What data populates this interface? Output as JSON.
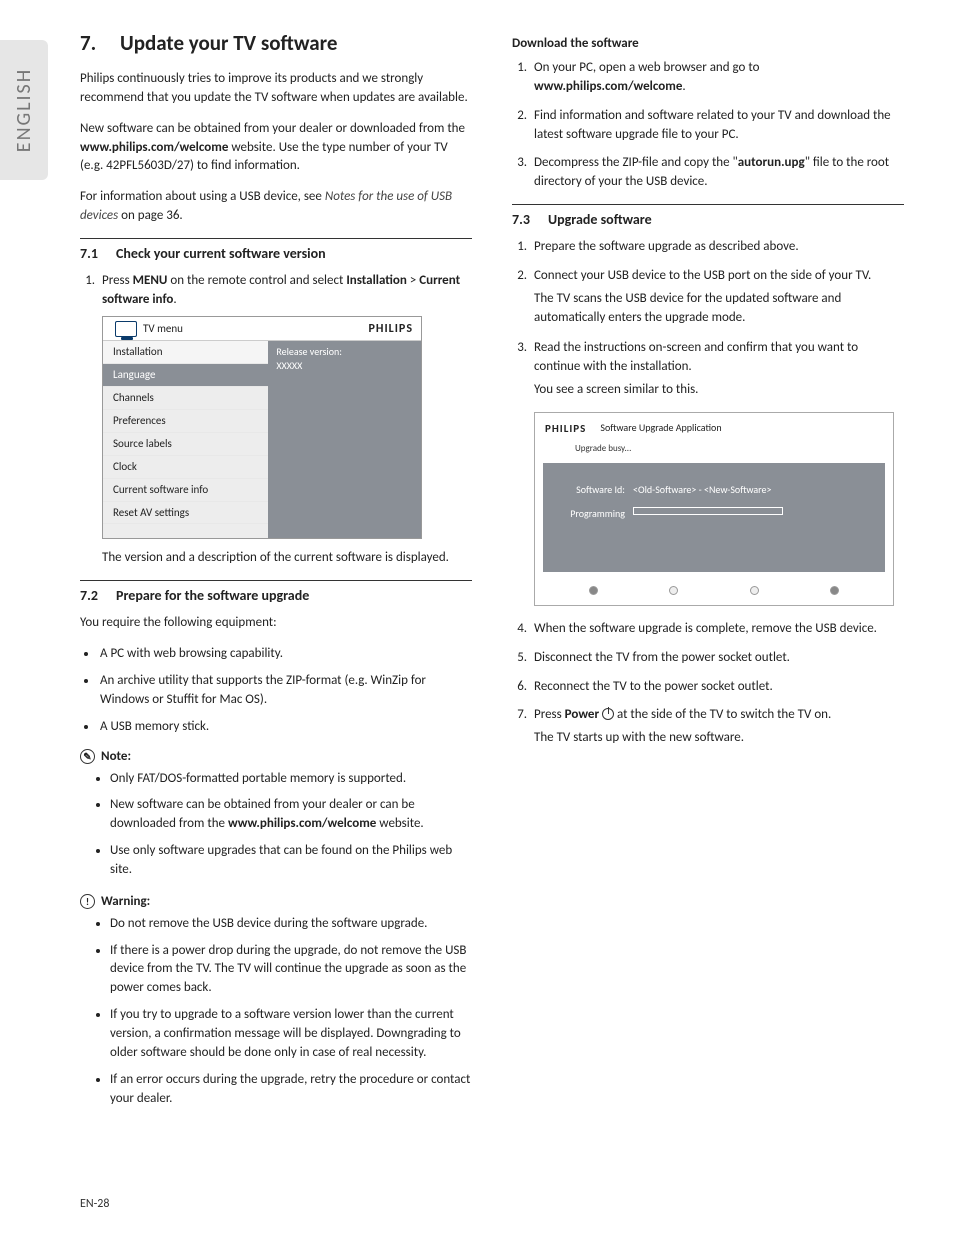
{
  "sideTab": "ENGLISH",
  "pageNumber": "EN-28",
  "chapter": {
    "num": "7.",
    "title": "Update your TV software"
  },
  "intro1a": "Philips continuously tries to improve its products and we strongly recommend that you update the TV software when updates are available.",
  "intro2a": "New software can be obtained from your dealer or downloaded from the ",
  "intro2b": "www.philips.com/welcome",
  "intro2c": " website.  Use the type number of your TV (e.g.  42PFL5603D/27) to find information.",
  "intro3a": "For information about using a USB device, see ",
  "intro3b": "Notes for the use of USB devices",
  "intro3c": " on page 36.",
  "s71": {
    "num": "7.1",
    "title": "Check your current software version"
  },
  "s71_step1a": "Press ",
  "s71_step1b": "MENU",
  "s71_step1c": " on the remote control and select ",
  "s71_step1d": "Installation",
  "s71_step1e": " > ",
  "s71_step1f": "Current software info",
  "s71_step1g": ".",
  "menuShot": {
    "brand": "PHILIPS",
    "tvMenu": "TV menu",
    "items": [
      "Installation",
      "Language",
      "Channels",
      "Preferences",
      "Source labels",
      "Clock",
      "Current software info",
      "Reset AV settings"
    ],
    "rightLabel": "Release version:",
    "rightValue": "XXXXX"
  },
  "s71_caption": "The version and a description of the current software is displayed.",
  "s72": {
    "num": "7.2",
    "title": "Prepare for the software upgrade"
  },
  "s72_intro": "You require the following equipment:",
  "s72_bullets": [
    "A PC with web browsing capability.",
    "An archive utility that supports the ZIP-format (e.g.  WinZip for Windows or Stuffit for Mac OS).",
    "A USB memory stick."
  ],
  "noteTitle": "Note:",
  "noteItems": {
    "n1": "Only FAT/DOS-formatted portable memory is supported.",
    "n2a": "New software can be obtained from your dealer or can be downloaded from the ",
    "n2b": "www.philips.com/welcome",
    "n2c": " website.",
    "n3": "Use only software upgrades that can be found on the Philips web site."
  },
  "warnTitle": "Warning:",
  "warnItems": [
    "Do not remove the USB device during the software upgrade.",
    "If there is a power drop during the upgrade, do not remove the USB device from the TV.  The TV will continue the upgrade as soon as the power comes back.",
    "If you try to upgrade to a software version lower than the current version, a confirmation message will be displayed.  Downgrading to older software should be done only in case of real necessity.",
    "If an error occurs during the upgrade, retry the procedure or contact your dealer."
  ],
  "dlTitle": "Download the software",
  "dl": {
    "s1a": "On your PC, open a web browser and go to ",
    "s1b": "www.philips.com/welcome",
    "s1c": ".",
    "s2": "Find information and software related to your TV and download the latest software upgrade file to your PC.",
    "s3a": "Decompress the ZIP-file and copy the \"",
    "s3b": "autorun.upg",
    "s3c": "\" file to the root directory of your the USB device."
  },
  "s73": {
    "num": "7.3",
    "title": "Upgrade software"
  },
  "s73_steps": {
    "s1": "Prepare the software upgrade as described above.",
    "s2": "Connect your USB device to the USB port on the side of your TV.",
    "s2b": "The TV scans the USB device for the updated software and automatically enters the upgrade mode.",
    "s3": "Read the instructions on-screen and confirm that you want to continue with the installation.",
    "s3b": "You see a screen similar to this."
  },
  "upgradeShot": {
    "brand": "PHILIPS",
    "title": "Software Upgrade Application",
    "sub": "Upgrade busy...",
    "idLabel": "Software Id:",
    "idValue": "<Old-Software> - <New-Software>",
    "progLabel": "Programming"
  },
  "s73_after": {
    "s4": "When the software upgrade is complete, remove the USB device.",
    "s5": "Disconnect the TV from the power socket outlet.",
    "s6": "Reconnect the TV to the power socket outlet.",
    "s7a": "Press ",
    "s7b": "Power",
    "s7c": " at the side of the TV to switch the TV on.",
    "s7d": "The TV starts up with the new software."
  }
}
